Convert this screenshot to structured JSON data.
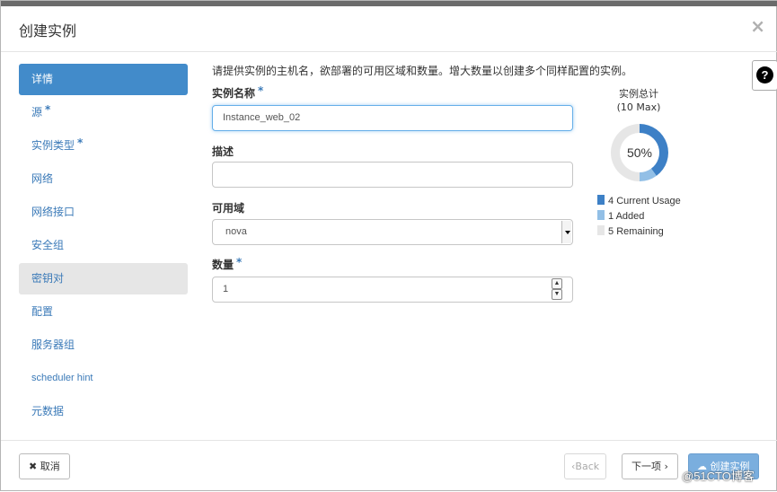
{
  "dialog": {
    "title": "创建实例",
    "close_icon": "×"
  },
  "nav": {
    "items": [
      {
        "label": "详情",
        "required": "",
        "state": "active"
      },
      {
        "label": "源",
        "required": "*",
        "state": ""
      },
      {
        "label": "实例类型",
        "required": "*",
        "state": ""
      },
      {
        "label": "网络",
        "required": "",
        "state": ""
      },
      {
        "label": "网络接口",
        "required": "",
        "state": ""
      },
      {
        "label": "安全组",
        "required": "",
        "state": ""
      },
      {
        "label": "密钥对",
        "required": "",
        "state": "hover"
      },
      {
        "label": "配置",
        "required": "",
        "state": ""
      },
      {
        "label": "服务器组",
        "required": "",
        "state": ""
      },
      {
        "label": "scheduler hint",
        "required": "",
        "state": ""
      },
      {
        "label": "元数据",
        "required": "",
        "state": ""
      }
    ]
  },
  "help": {
    "glyph": "?"
  },
  "form": {
    "description": "请提供实例的主机名，欲部署的可用区域和数量。增大数量以创建多个同样配置的实例。",
    "name_label": "实例名称",
    "name_value": "Instance_web_02",
    "desc_label": "描述",
    "desc_value": "",
    "zone_label": "可用域",
    "zone_value": "nova",
    "count_label": "数量",
    "count_value": "1",
    "required_mark": "*"
  },
  "quota_chart": {
    "title": "实例总计",
    "subtitle": "(10 Max)",
    "center_label": "50%",
    "colors": {
      "usage": "#3d80c6",
      "added": "#92bfe6",
      "remaining": "#e6e6e6"
    }
  },
  "chart_data": {
    "type": "pie",
    "title": "实例总计",
    "subtitle": "(10 Max)",
    "max": 10,
    "center_label": "50%",
    "categories": [
      "Current Usage",
      "Added",
      "Remaining"
    ],
    "values": [
      4,
      1,
      5
    ]
  },
  "footer": {
    "cancel_label": "取消",
    "cancel_icon": "✖",
    "back_label": "Back",
    "back_icon": "‹",
    "next_label": "下一项",
    "next_icon": "›",
    "create_label": "创建实例",
    "create_icon": "☁"
  },
  "watermark": "@51CTO博客"
}
